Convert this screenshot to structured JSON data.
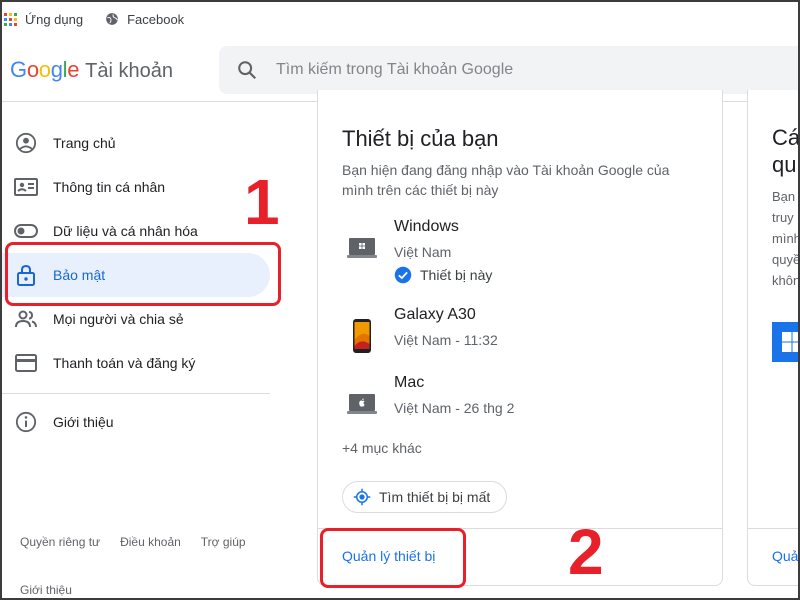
{
  "bookmarks": [
    {
      "label": "Ứng dụng",
      "icon": "apps-grid-icon"
    },
    {
      "label": "Facebook",
      "icon": "globe-icon"
    }
  ],
  "header": {
    "logo_letters": [
      "G",
      "o",
      "o",
      "g",
      "l",
      "e"
    ],
    "logo_colors": [
      "#4285F4",
      "#EA4335",
      "#FBBC05",
      "#4285F4",
      "#34A853",
      "#EA4335"
    ],
    "product": "Tài khoản",
    "search_placeholder": "Tìm kiếm trong Tài khoản Google"
  },
  "sidebar": {
    "items": [
      {
        "label": "Trang chủ",
        "icon": "account-circle-icon",
        "active": false
      },
      {
        "label": "Thông tin cá nhân",
        "icon": "id-card-icon",
        "active": false
      },
      {
        "label": "Dữ liệu và cá nhân hóa",
        "icon": "toggle-icon",
        "active": false
      },
      {
        "label": "Bảo mật",
        "icon": "lock-icon",
        "active": true
      },
      {
        "label": "Mọi người và chia sẻ",
        "icon": "people-icon",
        "active": false
      },
      {
        "label": "Thanh toán và đăng ký",
        "icon": "credit-card-icon",
        "active": false
      },
      {
        "label": "Giới thiệu",
        "icon": "info-icon",
        "active": false
      }
    ],
    "footer_links": [
      "Quyền riêng tư",
      "Điều khoản",
      "Trợ giúp"
    ],
    "footer_about": "Giới thiệu"
  },
  "devices_card": {
    "title": "Thiết bị của bạn",
    "description": "Bạn hiện đang đăng nhập vào Tài khoản Google của mình trên các thiết bị này",
    "devices": [
      {
        "name": "Windows",
        "location": "Việt Nam",
        "status": "Thiết bị này",
        "icon": "windows-laptop-icon"
      },
      {
        "name": "Galaxy A30",
        "location": "Việt Nam - 11:32",
        "icon": "phone-icon"
      },
      {
        "name": "Mac",
        "location": "Việt Nam - 26 thg 2",
        "icon": "mac-laptop-icon"
      }
    ],
    "more": "+4 mục khác",
    "find_button": "Tìm thiết bị bị mất",
    "manage_link": "Quản lý thiết bị"
  },
  "side_card": {
    "title_lines": [
      "Cá",
      "qu"
    ],
    "desc_lines": [
      "Bạn",
      "truy",
      "mình",
      "quyề",
      "khôn"
    ],
    "link": "Quả"
  },
  "annotations": {
    "step1": "1",
    "step2": "2",
    "color": "#e8202a"
  },
  "colors": {
    "accent": "#1a73e8",
    "active_bg": "#e8f0fe"
  }
}
